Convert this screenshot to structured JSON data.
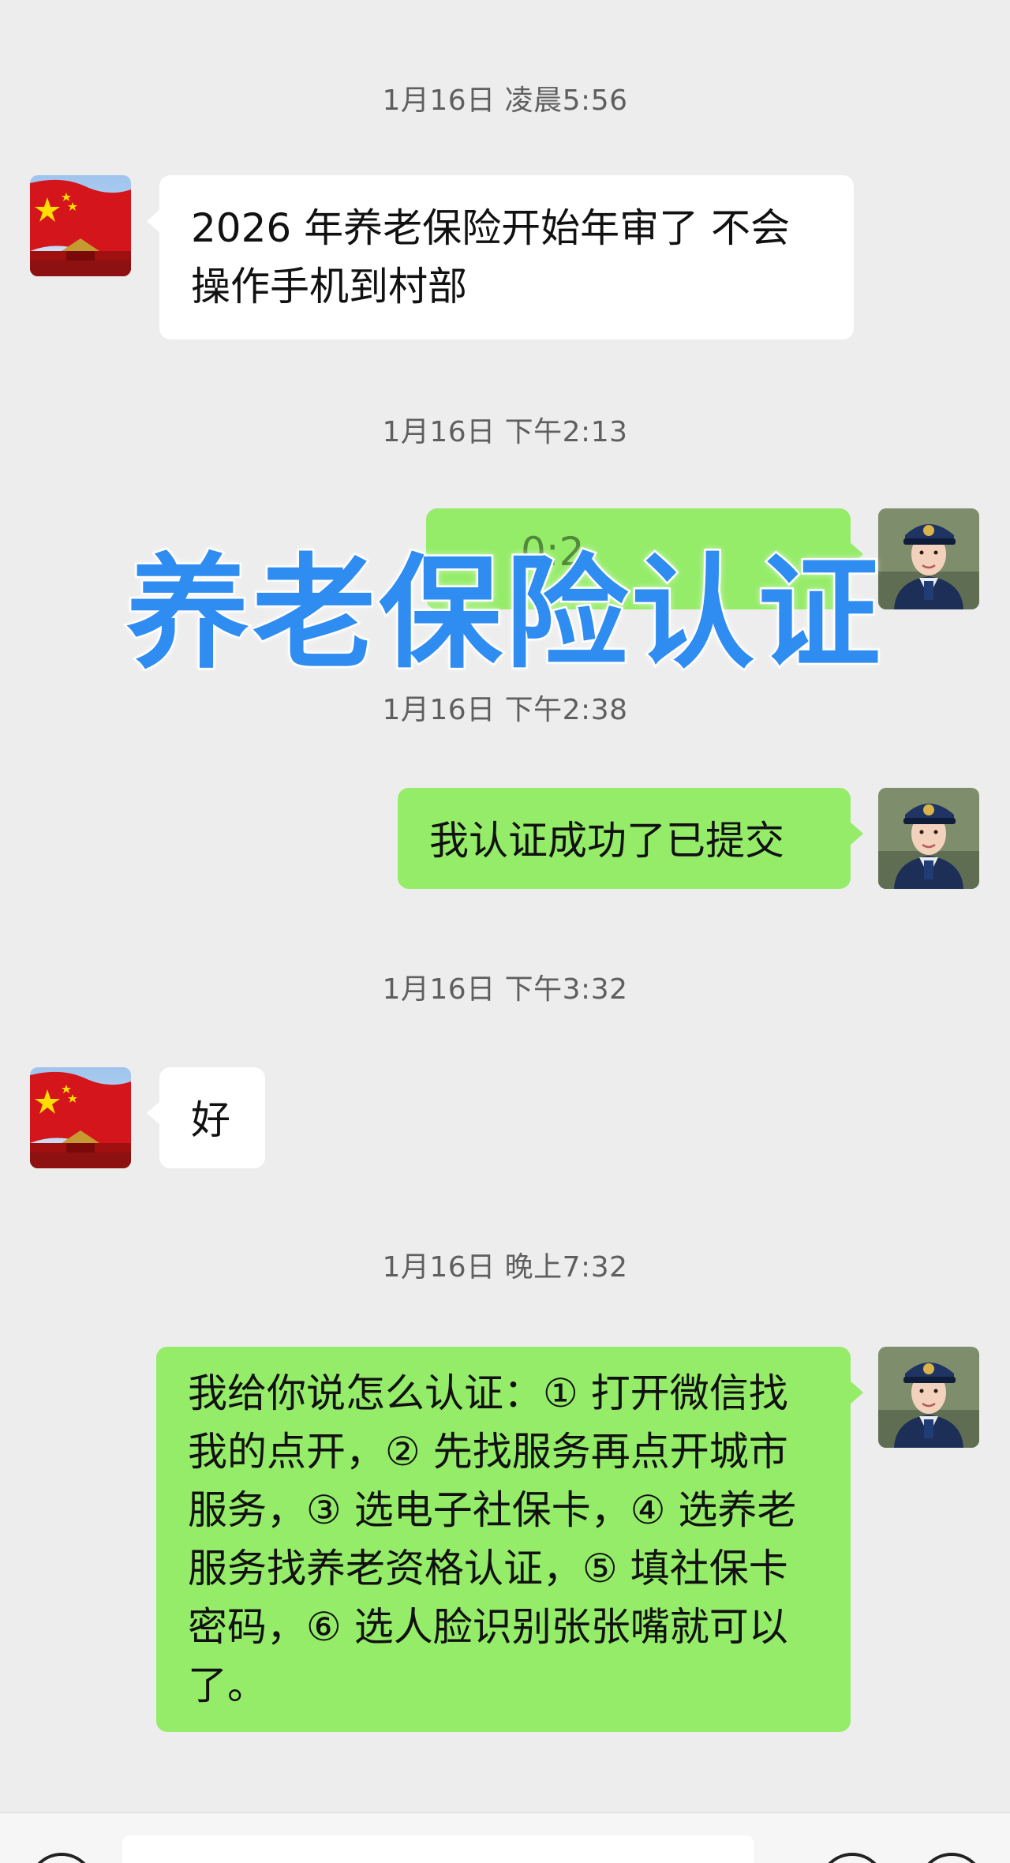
{
  "messages": [
    {
      "time": "1月16日 凌晨5:56",
      "sender": "other",
      "text": "2026 年养老保险开始年审了 不会操作手机到村部"
    },
    {
      "time": "1月16日 下午2:13",
      "sender": "self",
      "text": "0:2"
    },
    {
      "time": "1月16日 下午2:38",
      "sender": "self",
      "text": "我认证成功了已提交"
    },
    {
      "time": "1月16日 下午3:32",
      "sender": "other",
      "text": "好"
    },
    {
      "time": "1月16日 晚上7:32",
      "sender": "self",
      "text": "我给你说怎么认证：① 打开微信找我的点开，② 先找服务再点开城市服务，③ 选电子社保卡，④ 选养老服务找养老资格认证，⑤ 填社保卡密码，⑥ 选人脸识别张张嘴就可以了。"
    }
  ],
  "overlay": {
    "title": "养老保险认证"
  },
  "avatars": {
    "other": {
      "icon": "flag-tiananmen-avatar"
    },
    "self": {
      "icon": "uniformed-woman-avatar"
    }
  },
  "colors": {
    "background": "#ededed",
    "incoming_bubble": "#ffffff",
    "outgoing_bubble": "#95ec69",
    "overlay_text": "#2f8cf0"
  }
}
